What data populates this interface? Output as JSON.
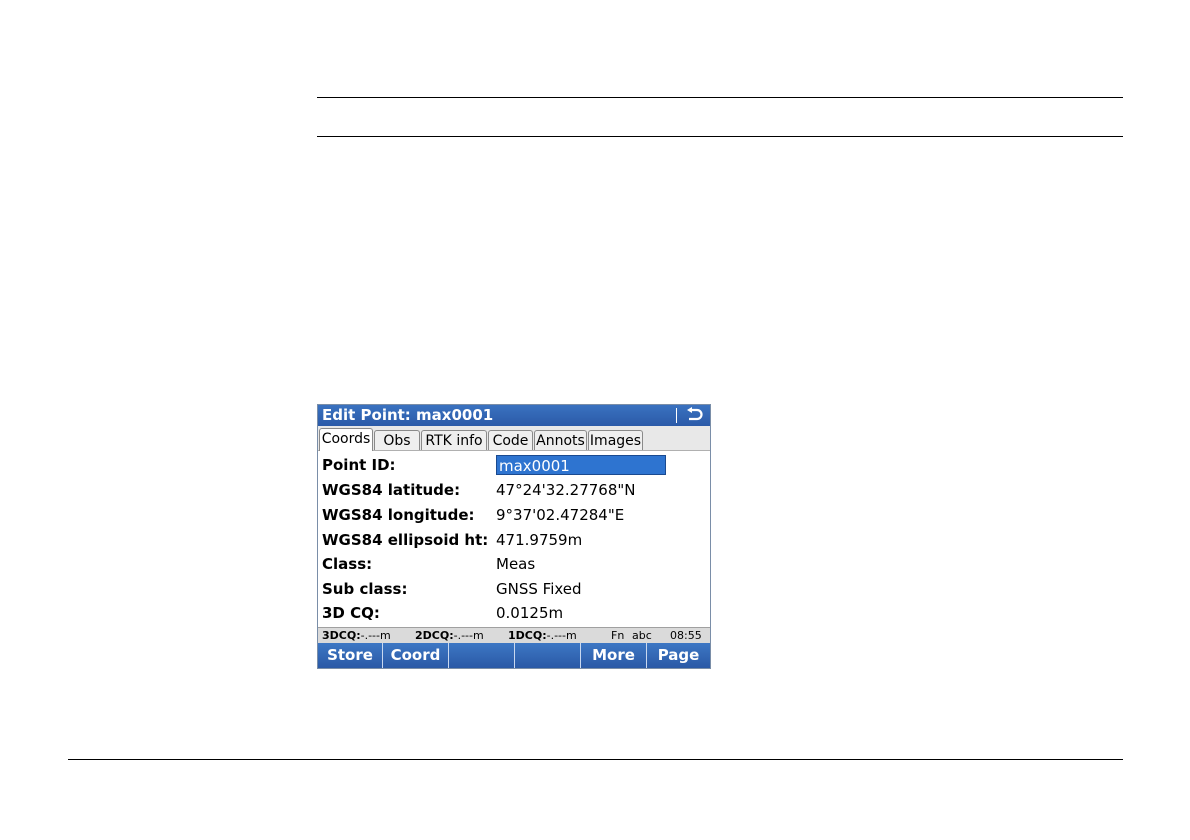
{
  "window": {
    "title": "Edit Point:  max0001",
    "back_icon": "back-arrow-icon"
  },
  "tabs": [
    {
      "label": "Coords",
      "active": true
    },
    {
      "label": "Obs"
    },
    {
      "label": "RTK info"
    },
    {
      "label": "Code"
    },
    {
      "label": "Annots"
    },
    {
      "label": "Images"
    }
  ],
  "fields": [
    {
      "label": "Point ID:",
      "value": "max0001"
    },
    {
      "label": "WGS84 latitude:",
      "value": "47°24'32.27768\"N"
    },
    {
      "label": "WGS84 longitude:",
      "value": "9°37'02.47284\"E"
    },
    {
      "label": "WGS84 ellipsoid ht:",
      "value": "471.9759m"
    },
    {
      "label": "Class:",
      "value": "Meas"
    },
    {
      "label": "Sub class:",
      "value": "GNSS Fixed"
    },
    {
      "label": "3D CQ:",
      "value": "0.0125m"
    }
  ],
  "status": {
    "cq3d_label": "3DCQ:",
    "cq3d_value": "-.---m",
    "cq2d_label": "2DCQ:",
    "cq2d_value": "-.---m",
    "cq1d_label": "1DCQ:",
    "cq1d_value": "-.---m",
    "fn": "Fn",
    "mode": "abc",
    "time": "08:55"
  },
  "softkeys": [
    "Store",
    "Coord",
    "",
    "",
    "More",
    "Page"
  ],
  "colors": {
    "title_bar": "#2b5aa8",
    "selected_field": "#2e74d0"
  }
}
